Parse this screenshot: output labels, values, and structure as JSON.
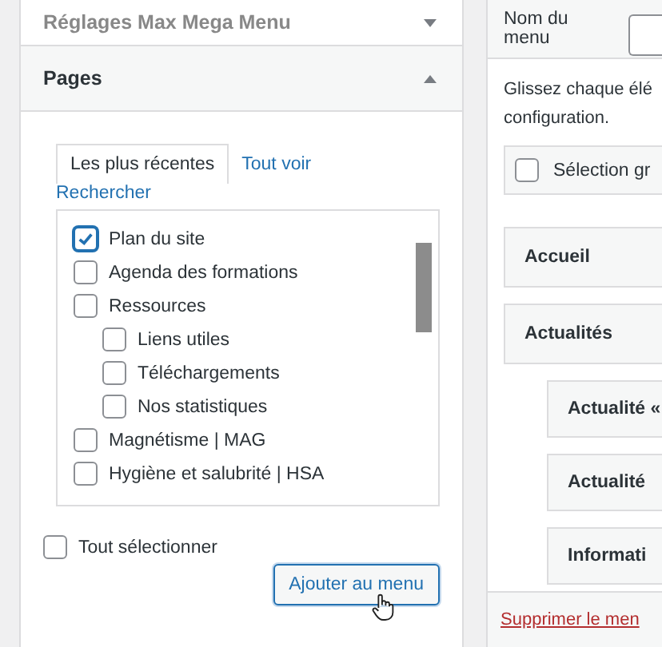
{
  "left_panel": {
    "collapsed_section": {
      "title": "Réglages Max Mega Menu",
      "expanded": false
    },
    "pages_section": {
      "title": "Pages",
      "expanded": true,
      "tabs": [
        {
          "label": "Les plus récentes",
          "selected": true
        },
        {
          "label": "Tout voir",
          "selected": false
        }
      ],
      "search_link": "Rechercher",
      "pages": [
        {
          "label": "Plan du site",
          "checked": true
        },
        {
          "label": "Agenda des formations",
          "checked": false
        },
        {
          "label": "Ressources",
          "checked": false,
          "children": [
            {
              "label": "Liens utiles",
              "checked": false
            },
            {
              "label": "Téléchargements",
              "checked": false
            },
            {
              "label": "Nos statistiques",
              "checked": false
            }
          ]
        },
        {
          "label": "Magnétisme | MAG",
          "checked": false
        },
        {
          "label": "Hygiène et salubrité | HSA",
          "checked": false
        }
      ],
      "select_all": {
        "label": "Tout sélectionner",
        "checked": false
      },
      "add_button": "Ajouter au menu"
    }
  },
  "right_panel": {
    "menu_name_label": "Nom du menu",
    "instructions": "Glissez chaque élé\nconfiguration.",
    "bulk_select": {
      "label": "Sélection gr",
      "checked": false
    },
    "menu_items": [
      {
        "label": "Accueil"
      },
      {
        "label": "Actualités",
        "children": [
          {
            "label": "Actualité «"
          },
          {
            "label": "Actualité"
          },
          {
            "label": "Informati"
          }
        ]
      }
    ],
    "delete_link": "Supprimer le men"
  }
}
